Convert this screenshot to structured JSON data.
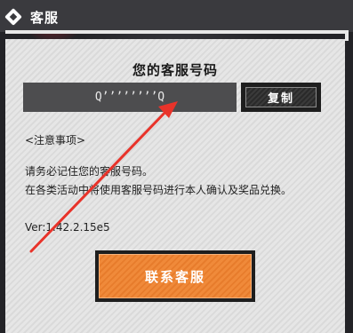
{
  "header": {
    "title": "客服"
  },
  "dialog": {
    "title": "您的客服号码",
    "code_value": "QʼʼʼʼʼʼʼʼQ",
    "copy_label": "复制",
    "notice_header": "<注意事项>",
    "notice_line_1": "请务必记住您的客服号码。",
    "notice_line_2": "在各类活动中将使用客服号码进行本人确认及奖品兑换。",
    "version": "Ver:1.42.2.15e5",
    "contact_label": "联系客服"
  },
  "colors": {
    "accent_orange": "#f08a3a",
    "annotation_red": "#e8332a"
  },
  "icons": {
    "back": "back-diamond-icon",
    "annotation": "red-arrow"
  }
}
